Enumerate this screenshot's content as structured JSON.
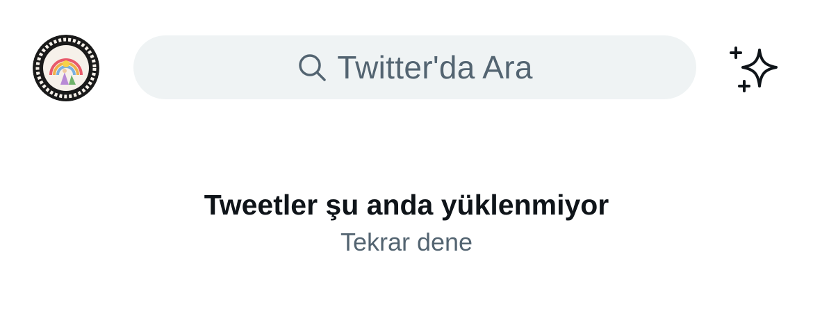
{
  "colors": {
    "background": "#ffffff",
    "search_bg": "#eff3f4",
    "secondary_text": "#536471",
    "primary_text": "#0f1419"
  },
  "header": {
    "avatar_icon": "profile-avatar",
    "search": {
      "placeholder": "Twitter'da Ara",
      "icon": "search-icon"
    },
    "sparkle_icon": "sparkle-icon"
  },
  "main": {
    "error_title": "Tweetler şu anda yüklenmiyor",
    "retry_label": "Tekrar dene"
  }
}
